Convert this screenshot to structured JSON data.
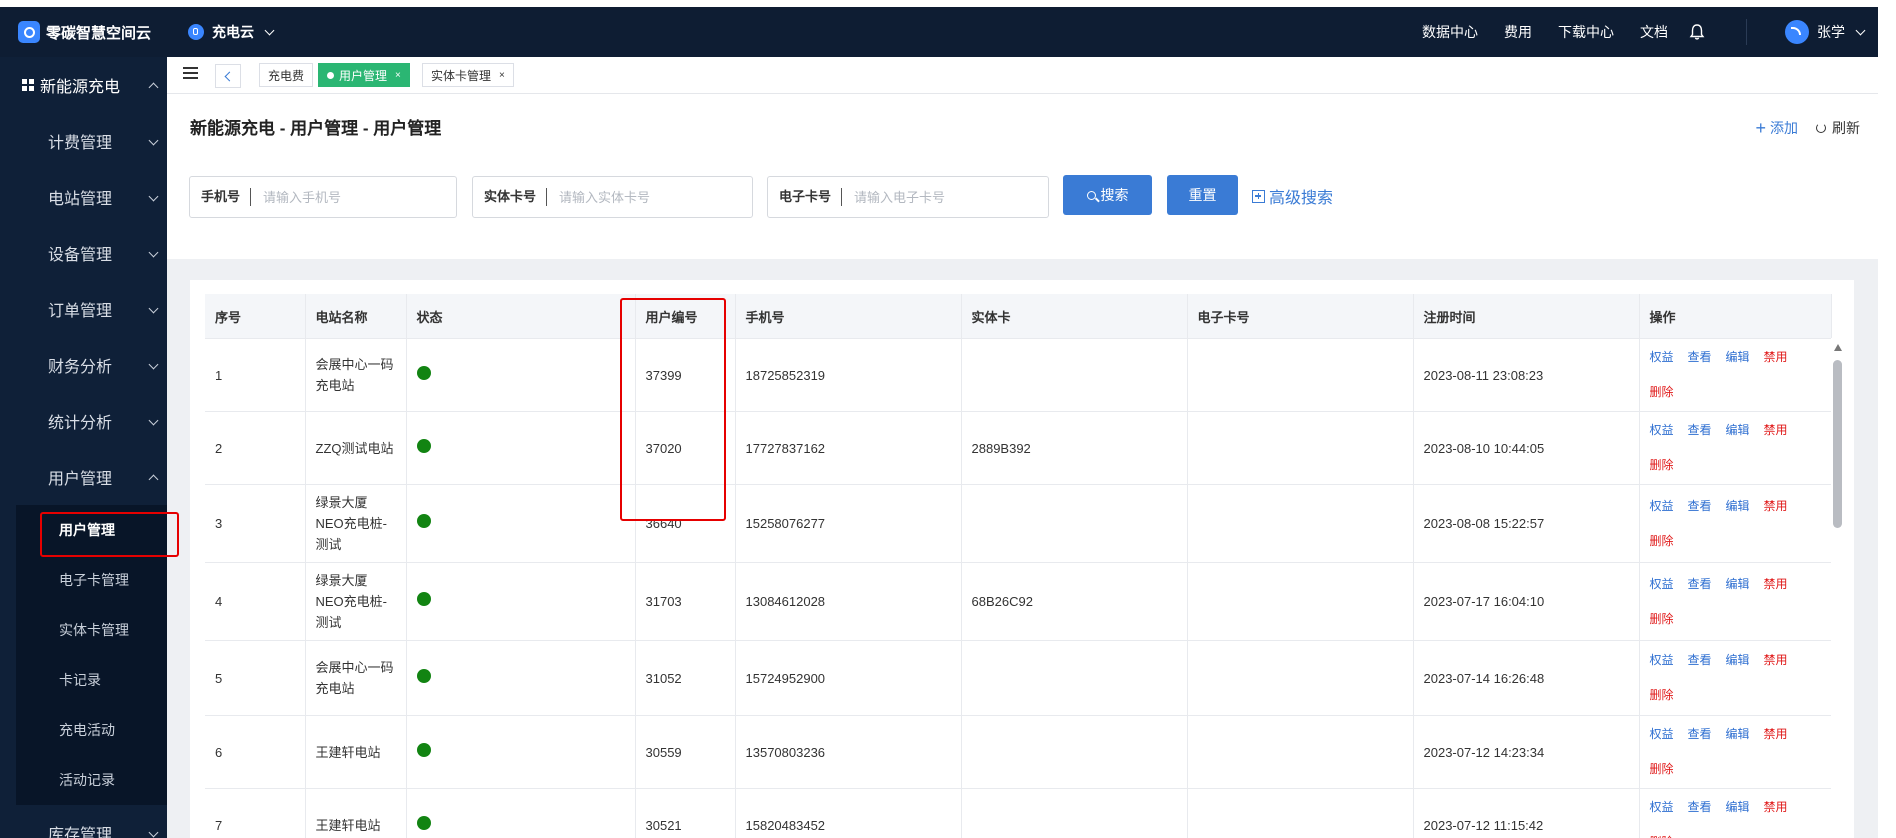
{
  "brand": {
    "name": "零碳智慧空间云"
  },
  "app_switch": {
    "label": "充电云"
  },
  "topnav": {
    "items": [
      "数据中心",
      "费用",
      "下载中心",
      "文档"
    ],
    "user": "张学"
  },
  "sidebar": {
    "root": "新能源充电",
    "groups": [
      "计费管理",
      "电站管理",
      "设备管理",
      "订单管理",
      "财务分析",
      "统计分析",
      "用户管理"
    ],
    "user_sub": [
      "用户管理",
      "电子卡管理",
      "实体卡管理",
      "卡记录",
      "充电活动",
      "活动记录"
    ],
    "last_group": "库存管理"
  },
  "tabs": [
    {
      "label": "充电费"
    },
    {
      "label": "用户管理"
    },
    {
      "label": "实体卡管理"
    }
  ],
  "page": {
    "title": "新能源充电 - 用户管理 - 用户管理",
    "add_label": "添加",
    "refresh_label": "刷新"
  },
  "search": {
    "phone": {
      "label": "手机号",
      "placeholder": "请输入手机号"
    },
    "card": {
      "label": "实体卡号",
      "placeholder": "请输入实体卡号"
    },
    "ecard": {
      "label": "电子卡号",
      "placeholder": "请输入电子卡号"
    },
    "search_label": "搜索",
    "reset_label": "重置",
    "advanced_label": "高级搜索"
  },
  "table": {
    "columns": [
      "序号",
      "电站名称",
      "状态",
      "用户编号",
      "手机号",
      "实体卡",
      "电子卡号",
      "注册时间",
      "操作"
    ],
    "ops": {
      "rights": "权益",
      "view": "查看",
      "edit": "编辑",
      "disable": "禁用",
      "delete": "删除"
    },
    "rows": [
      {
        "idx": "1",
        "station": "会展中心一码充电站",
        "status_color": "#128412",
        "user_id": "37399",
        "phone": "18725852319",
        "card": "",
        "ecard": "",
        "time": "2023-08-11 23:08:23"
      },
      {
        "idx": "2",
        "station": "ZZQ测试电站",
        "status_color": "#128412",
        "user_id": "37020",
        "phone": "17727837162",
        "card": "2889B392",
        "ecard": "",
        "time": "2023-08-10 10:44:05"
      },
      {
        "idx": "3",
        "station": "绿景大厦NEO充电桩-测试",
        "status_color": "#128412",
        "user_id": "36640",
        "phone": "15258076277",
        "card": "",
        "ecard": "",
        "time": "2023-08-08 15:22:57"
      },
      {
        "idx": "4",
        "station": "绿景大厦NEO充电桩-测试",
        "status_color": "#128412",
        "user_id": "31703",
        "phone": "13084612028",
        "card": "68B26C92",
        "ecard": "",
        "time": "2023-07-17 16:04:10"
      },
      {
        "idx": "5",
        "station": "会展中心一码充电站",
        "status_color": "#128412",
        "user_id": "31052",
        "phone": "15724952900",
        "card": "",
        "ecard": "",
        "time": "2023-07-14 16:26:48"
      },
      {
        "idx": "6",
        "station": "王建轩电站",
        "status_color": "#128412",
        "user_id": "30559",
        "phone": "13570803236",
        "card": "",
        "ecard": "",
        "time": "2023-07-12 14:23:34"
      },
      {
        "idx": "7",
        "station": "王建轩电站",
        "status_color": "#128412",
        "user_id": "30521",
        "phone": "15820483452",
        "card": "",
        "ecard": "",
        "time": "2023-07-12 11:15:42"
      }
    ]
  }
}
